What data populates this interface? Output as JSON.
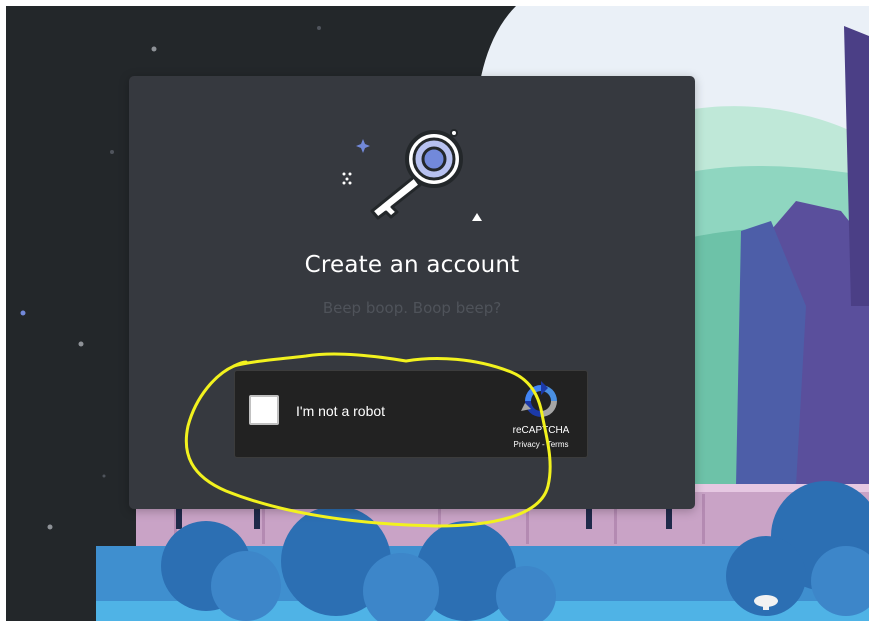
{
  "modal": {
    "title": "Create an account",
    "subtitle": "Beep boop. Boop beep?",
    "illustration_icon": "key-icon"
  },
  "recaptcha": {
    "label": "I'm not a robot",
    "brand": "reCAPTCHA",
    "privacy_label": "Privacy",
    "separator": " - ",
    "terms_label": "Terms",
    "checked": false,
    "logo_icon": "recaptcha-logo-icon"
  },
  "colors": {
    "modal_bg": "#36393f",
    "dark_blob": "#23272a",
    "accent_purple": "#7289da",
    "highlight_yellow": "#f2f21e",
    "recaptcha_bg": "#222222"
  }
}
